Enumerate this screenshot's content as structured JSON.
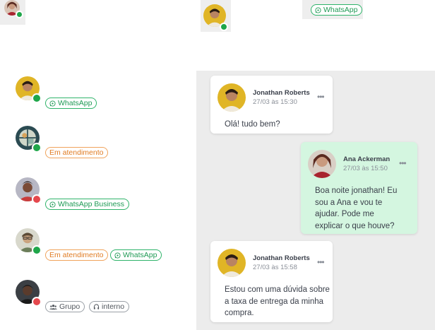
{
  "top": {
    "whatsapp_badge": "WhatsApp"
  },
  "contacts": [
    {
      "badges": [
        {
          "label": "WhatsApp",
          "kind": "green",
          "icon": "whatsapp-icon"
        }
      ],
      "status": "online"
    },
    {
      "badges": [
        {
          "label": "Em atendimento",
          "kind": "orange",
          "icon": ""
        }
      ],
      "status": "online"
    },
    {
      "badges": [
        {
          "label": "WhatsApp Business",
          "kind": "green",
          "icon": "whatsapp-icon"
        }
      ],
      "status": "offline"
    },
    {
      "badges": [
        {
          "label": "Em atendimento",
          "kind": "orange",
          "icon": ""
        },
        {
          "label": "WhatsApp",
          "kind": "green",
          "icon": "whatsapp-icon"
        }
      ],
      "status": "online"
    },
    {
      "badges": [
        {
          "label": "Grupo",
          "kind": "gray",
          "icon": "group-icon"
        },
        {
          "label": "interno",
          "kind": "gray",
          "icon": "headset-icon"
        }
      ],
      "status": "offline"
    }
  ],
  "messages": [
    {
      "author": "Jonathan Roberts",
      "time": "27/03 às 15:30",
      "text": "Olá! tudo bem?",
      "mine": false
    },
    {
      "author": "Ana Ackerman",
      "time": "27/03 às 15:50",
      "text": "Boa noite jonathan! Eu sou a Ana e vou te ajudar. Pode me explicar o que houve?",
      "mine": true
    },
    {
      "author": "Jonathan Roberts",
      "time": "27/03 às 15:58",
      "text": "Estou com uma dúvida sobre a taxa de entrega da minha compra.",
      "mine": false
    }
  ],
  "colors": {
    "online": "#1fa64a",
    "offline": "#e5484d",
    "whatsapp_green": "#2fb36a",
    "attending_orange": "#f0a35c",
    "my_bubble": "#d4f6e0",
    "chat_background": "#ececec"
  },
  "menu_glyph": "•••"
}
